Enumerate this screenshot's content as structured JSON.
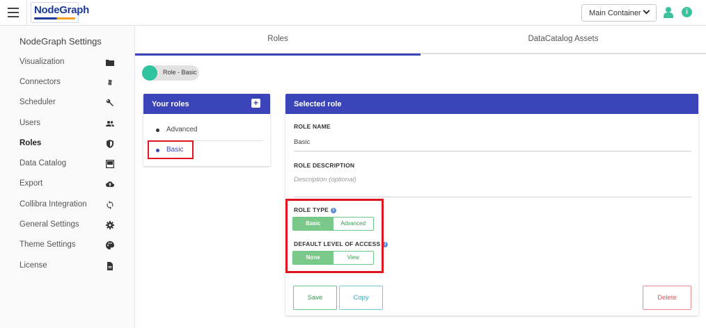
{
  "header": {
    "logo_text": "NodeGraph",
    "container_select": {
      "value": "Main Container"
    }
  },
  "sidebar": {
    "title": "NodeGraph Settings",
    "items": [
      {
        "label": "Visualization",
        "icon": "folder-icon"
      },
      {
        "label": "Connectors",
        "icon": "swap-vert-icon"
      },
      {
        "label": "Scheduler",
        "icon": "wrench-icon"
      },
      {
        "label": "Users",
        "icon": "people-icon"
      },
      {
        "label": "Roles",
        "icon": "shield-icon",
        "active": true
      },
      {
        "label": "Data Catalog",
        "icon": "inbox-icon"
      },
      {
        "label": "Export",
        "icon": "cloud-upload-icon"
      },
      {
        "label": "Collibra Integration",
        "icon": "sync-icon"
      },
      {
        "label": "General Settings",
        "icon": "gear-icon"
      },
      {
        "label": "Theme Settings",
        "icon": "palette-icon"
      },
      {
        "label": "License",
        "icon": "document-icon"
      }
    ]
  },
  "tabs": [
    {
      "label": "Roles",
      "active": true
    },
    {
      "label": "DataCatalog Assets",
      "active": false
    }
  ],
  "role_chip": {
    "label": "Role - Basic"
  },
  "your_roles": {
    "title": "Your roles",
    "items": [
      {
        "name": "Advanced",
        "active": false
      },
      {
        "name": "Basic",
        "active": true
      }
    ]
  },
  "selected_role": {
    "title": "Selected role",
    "role_name_label": "ROLE NAME",
    "role_name_value": "Basic",
    "role_description_label": "ROLE DESCRIPTION",
    "role_description_placeholder": "Description (optional)",
    "role_type_label": "ROLE TYPE",
    "role_type_options": [
      "Basic",
      "Advanced"
    ],
    "role_type_selected": "Basic",
    "access_label": "DEFAULT LEVEL OF ACCESS",
    "access_options": [
      "None",
      "View"
    ],
    "access_selected": "None",
    "save_label": "Save",
    "copy_label": "Copy",
    "delete_label": "Delete"
  },
  "colors": {
    "primary": "#3a44b8",
    "accent_green": "#2ec4a0",
    "highlight_red": "#e0141e"
  }
}
